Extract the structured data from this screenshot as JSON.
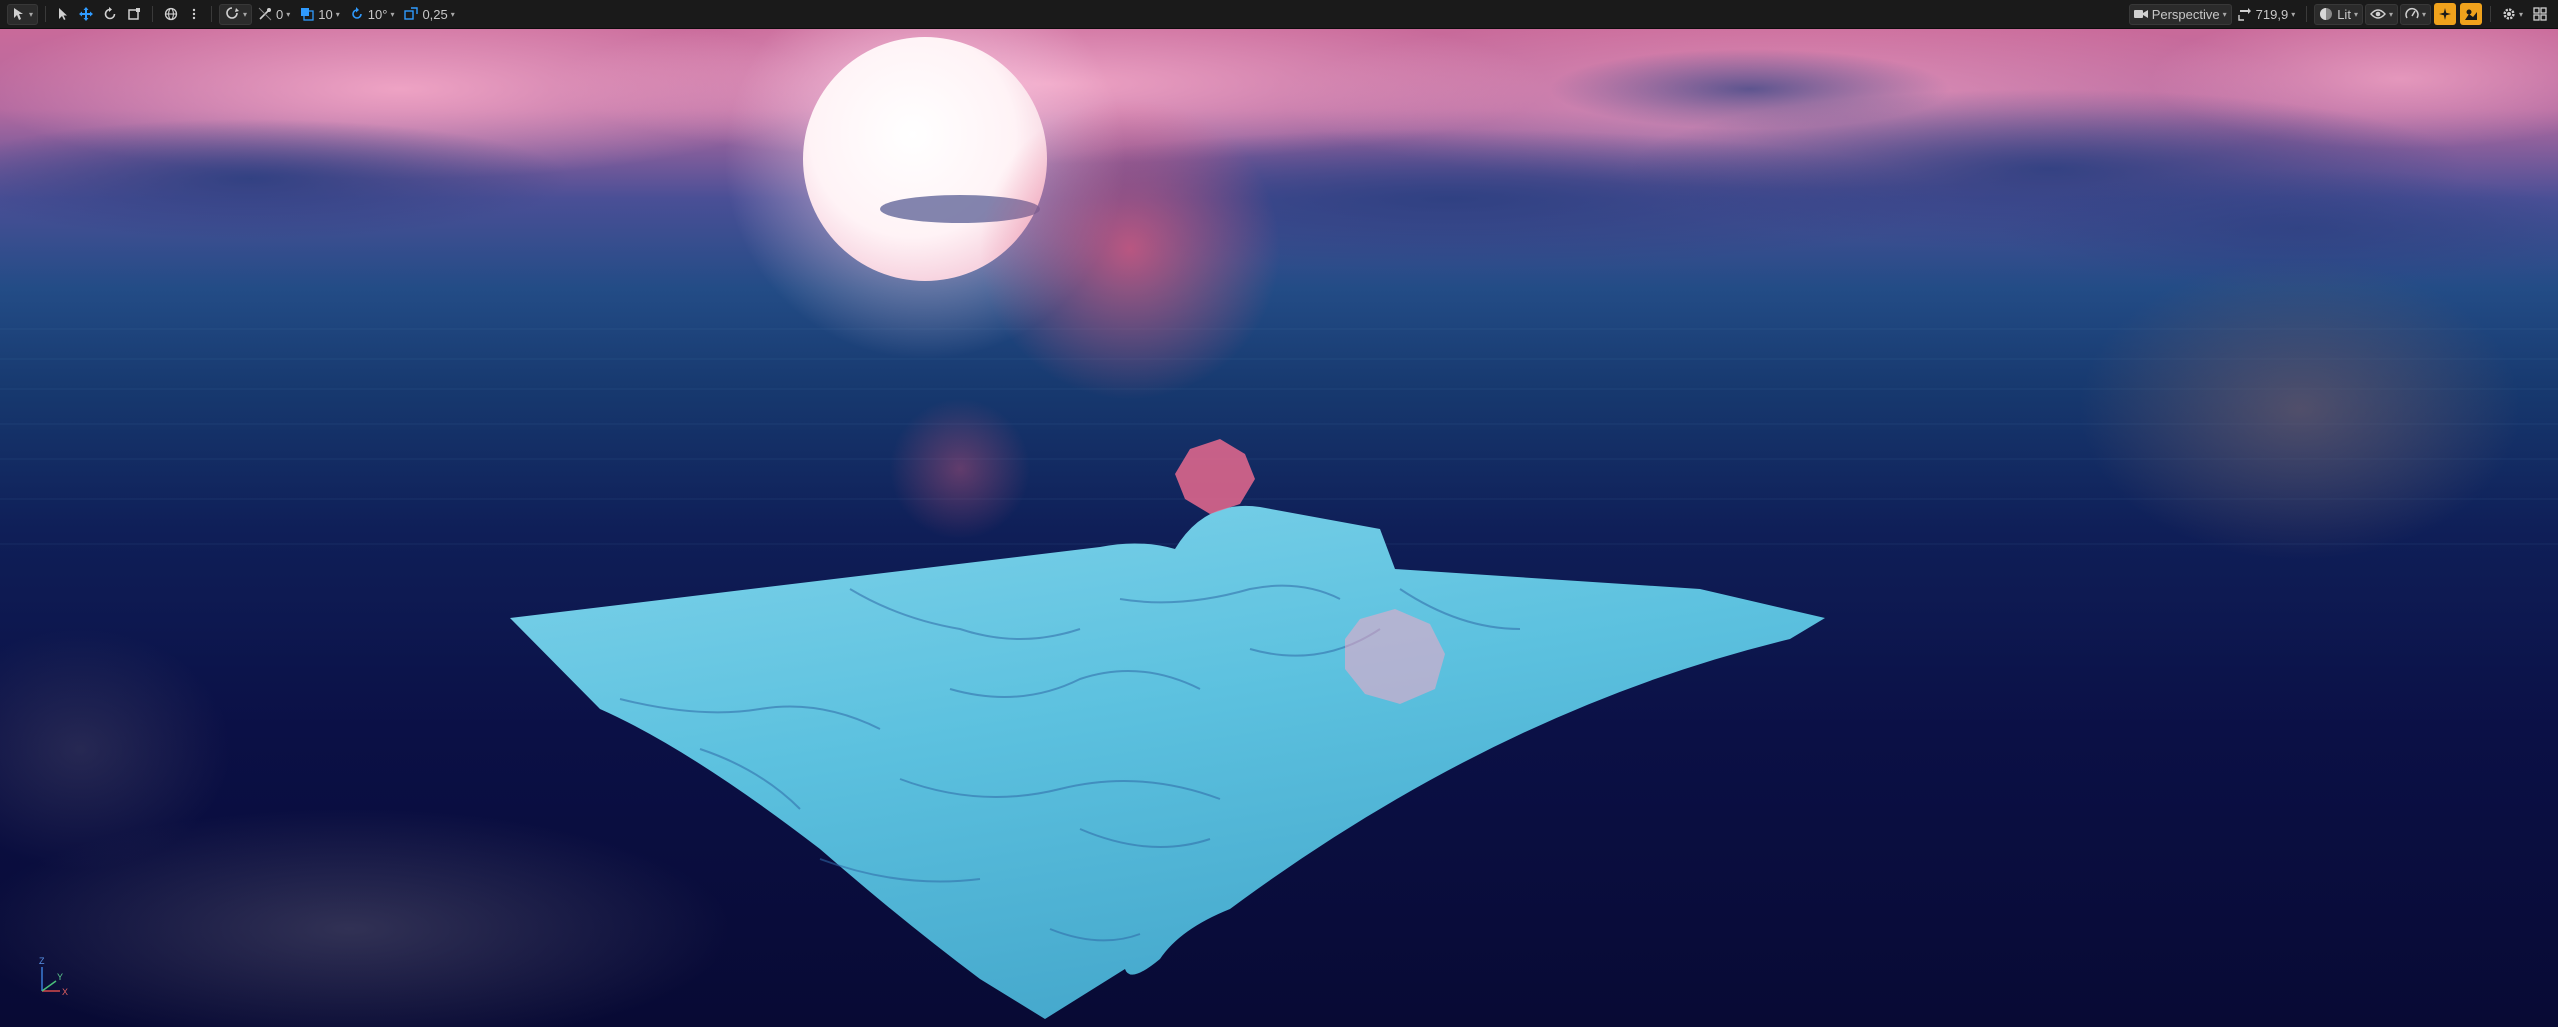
{
  "toolbar": {
    "left": {
      "select_mode_icon": "select-mode-icon",
      "transform_tools": [
        "select-arrow-icon",
        "translate-icon",
        "rotate-icon",
        "scale-icon"
      ],
      "world_local_icon": "globe-icon",
      "more_icon": "kebab-icon",
      "surface_snap_icon": "surface-snap-icon",
      "snap_toggle_icon": "snap-toggle-icon",
      "snap_toggle_value": "0",
      "grid_snap_value": "10",
      "rotation_snap_value": "10°",
      "scale_snap_value": "0,25"
    },
    "right": {
      "view_mode_label": "Perspective",
      "camera_speed_value": "719,9",
      "lit_label": "Lit",
      "show_icon": "eye-icon",
      "realtime_icon": "performance-icon",
      "orange_buttons": [
        "sparkle-icon",
        "game-view-icon"
      ],
      "settings_icon": "gear-icon",
      "layout_icon": "grid-layout-icon"
    }
  },
  "viewport": {
    "gizmo": {
      "z_label": "Z",
      "x_label": "X",
      "y_label": "Y"
    },
    "colors": {
      "sky_top": "#b85a8c",
      "sky_horizon": "#1d3c7a",
      "ocean": "#0b0d3a",
      "terrain": "#5fc4e0",
      "sun": "#fff4f4"
    }
  }
}
